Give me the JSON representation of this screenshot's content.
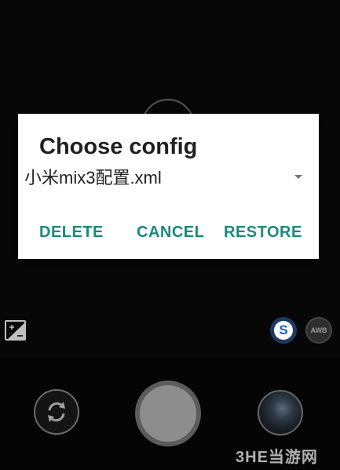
{
  "dialog": {
    "title": "Choose config",
    "selected_config": "小米mix3配置.xml",
    "buttons": {
      "delete": "DELETE",
      "cancel": "CANCEL",
      "restore": "RESTORE"
    },
    "accent_color": "#1a8a7a"
  },
  "camera": {
    "scene_badge": "S",
    "awb_badge": "AWB",
    "scene_badge_color": "#1565c0"
  },
  "watermark": "3HE当游网"
}
